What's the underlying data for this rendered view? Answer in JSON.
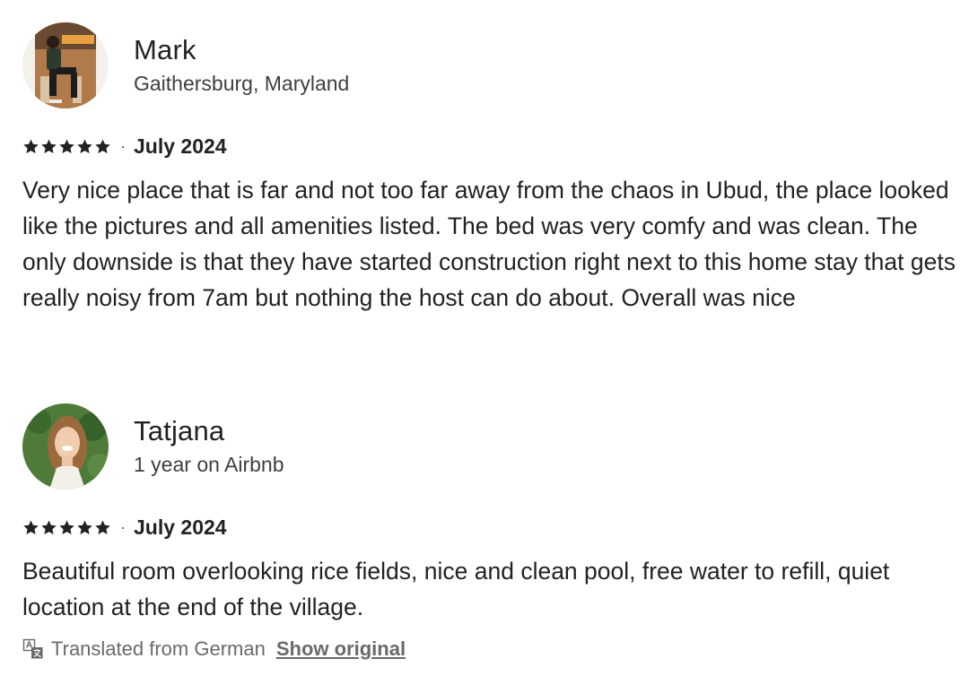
{
  "reviews": [
    {
      "name": "Mark",
      "subtitle": "Gaithersburg, Maryland",
      "rating": 5,
      "separator": "·",
      "date": "July 2024",
      "text": "Very nice place that is far and not too far away from the chaos in Ubud, the place looked like the pictures and all amenities listed. The bed was very comfy and was clean. The only downside is that they have started construction right next to this home stay that gets really noisy from 7am but nothing the host can do about. Overall was nice"
    },
    {
      "name": "Tatjana",
      "subtitle": "1 year on Airbnb",
      "rating": 5,
      "separator": "·",
      "date": "July 2024",
      "text": "Beautiful room overlooking rice fields, nice and clean pool, free water to refill, quiet location at the end of the village.",
      "translation_note": "Translated from German",
      "show_original_label": "Show original"
    }
  ],
  "icons": {
    "star": "star-icon",
    "translate": "translate-icon"
  },
  "colors": {
    "text": "#222222",
    "muted": "#6a6a6a"
  }
}
